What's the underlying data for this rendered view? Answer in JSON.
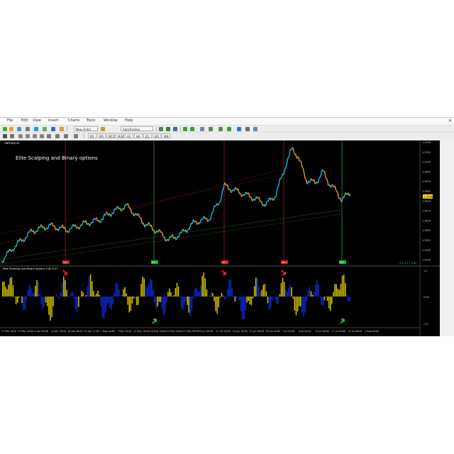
{
  "menu": [
    "File",
    "Edit",
    "View",
    "Insert",
    "Charts",
    "Tools",
    "Window",
    "Help"
  ],
  "toolbar": {
    "autotrading_label": "AutoTrading",
    "new_order_label": "New Order",
    "timeframes": [
      "M1",
      "M5",
      "M15",
      "M30",
      "H1",
      "H4",
      "D1",
      "W1",
      "MN"
    ]
  },
  "main_chart": {
    "symbol_label": "GBPUSD,H4",
    "watermark": "Elite Scalping and Binary options",
    "price_axis": [
      "1.3790",
      "1.3745",
      "1.3700",
      "1.3655",
      "1.3610",
      "1.3565",
      "1.3520",
      "1.3475",
      "1.3430",
      "1.3385",
      "1.3340",
      "1.3295",
      "1.3250"
    ],
    "current_price": "1.3588",
    "bottom_right_text": "4  4  4  1  7 3  4h"
  },
  "indicator": {
    "title": "Elite Scalping and Binary options  0.00  0.27",
    "axis": [
      "1.0",
      "0.00",
      "-1.0"
    ]
  },
  "time_axis": [
    "27 Mar 2018",
    "27 Mar 16:00",
    "4 Apr 08:00",
    "10 Apr 20:00",
    "18 Apr 16:00",
    "24 Apr 12:00",
    "1 May 04:00",
    "7 May 20:00",
    "14 May 16:00",
    "18 May 20:00",
    "24 May 16:00",
    "31 May 08:00",
    "6 Jun 08:00",
    "11 Jun 04:00",
    "15 Jun 16:00",
    "22 Jun 08:00",
    "26 Jun 20:00",
    "3 Jul 20:00",
    "6 Jul 04:00",
    "12 Jul 08:00",
    "17 Jul 04:00",
    "23 Jul 08:00",
    "1 Aug 04:00"
  ],
  "signals": {
    "sell_badge": "SELL",
    "buy_badge": "BUY"
  },
  "colors": {
    "chart_bg": "#000000",
    "bull_candle": "#00c8ff",
    "bear_candle": "#ffaa00",
    "sell_line": "#8b1a1a",
    "buy_line": "#1f8a2a",
    "hist_yellow": "#d4c400",
    "hist_blue": "#0f2bd8",
    "sell_arrow": "#ff2a2a",
    "buy_arrow": "#3ad24a"
  }
}
